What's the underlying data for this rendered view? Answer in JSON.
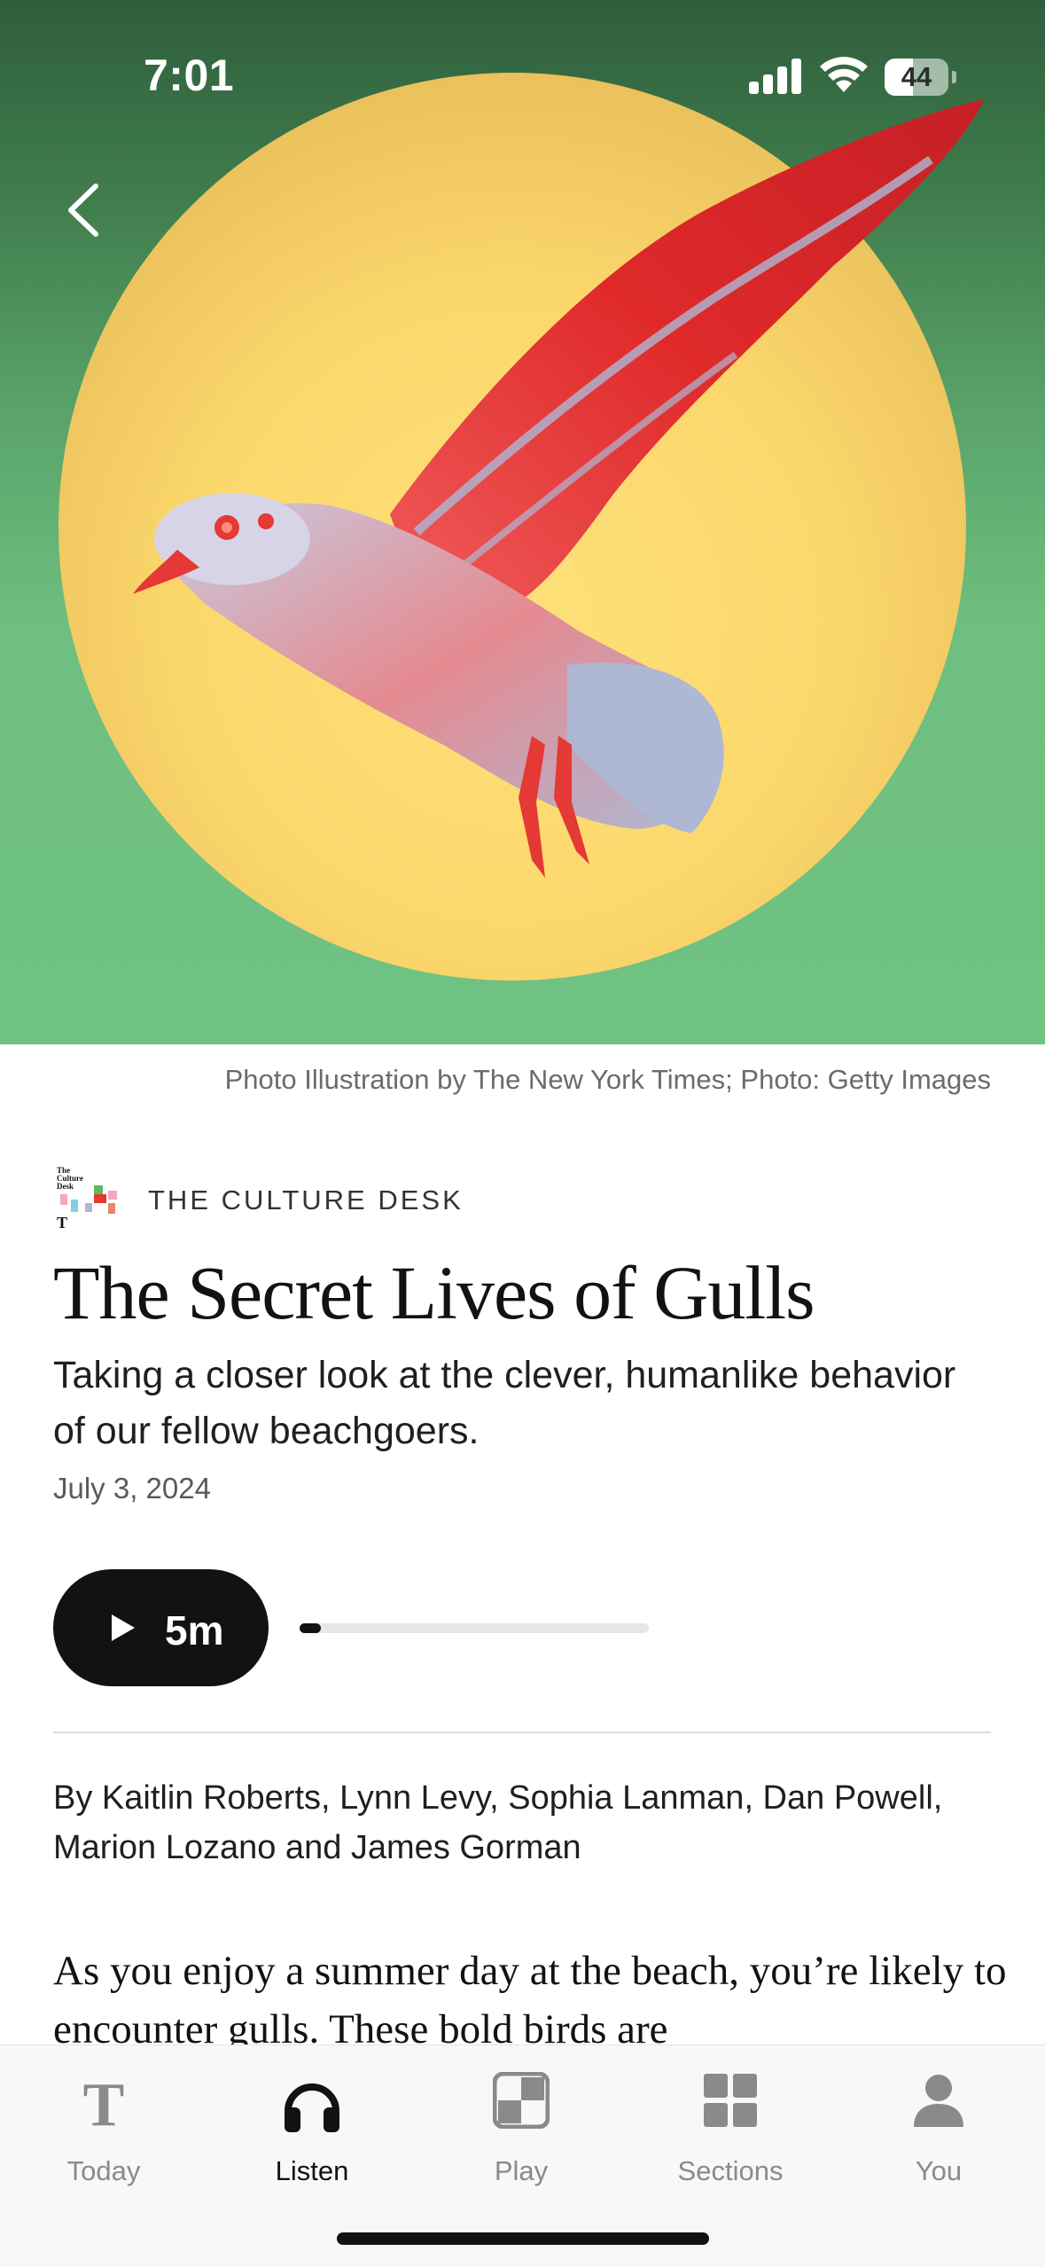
{
  "status_bar": {
    "time": "7:01",
    "battery": "44",
    "battery_level": 0.44
  },
  "hero": {
    "caption": "Photo Illustration by The New York Times; Photo: Getty Images"
  },
  "article": {
    "series": "THE CULTURE DESK",
    "series_logo_text": "The Culture Desk",
    "headline": "The Secret Lives of Gulls",
    "summary": "Taking a closer look at the clever, humanlike behavior of our fellow beachgoers.",
    "date": "July 3, 2024",
    "byline": "By Kaitlin Roberts, Lynn Levy, Sophia Lanman, Dan Powell, Marion Lozano and James Gorman",
    "body": "As you enjoy a summer day at the beach, you’re likely to encounter gulls. These bold birds are"
  },
  "player": {
    "duration": "5m",
    "progress": 0.06
  },
  "tabs": [
    {
      "label": "Today",
      "icon": "nyt-logo-icon"
    },
    {
      "label": "Listen",
      "icon": "headphones-icon"
    },
    {
      "label": "Play",
      "icon": "play-games-icon"
    },
    {
      "label": "Sections",
      "icon": "sections-grid-icon"
    },
    {
      "label": "You",
      "icon": "person-icon"
    }
  ],
  "colors": {
    "accent": "#121212",
    "hero_green": "#6fbf80",
    "sun_yellow": "#fcd86c",
    "bird_red": "#e53935",
    "bird_gray": "#aeb8d4"
  }
}
